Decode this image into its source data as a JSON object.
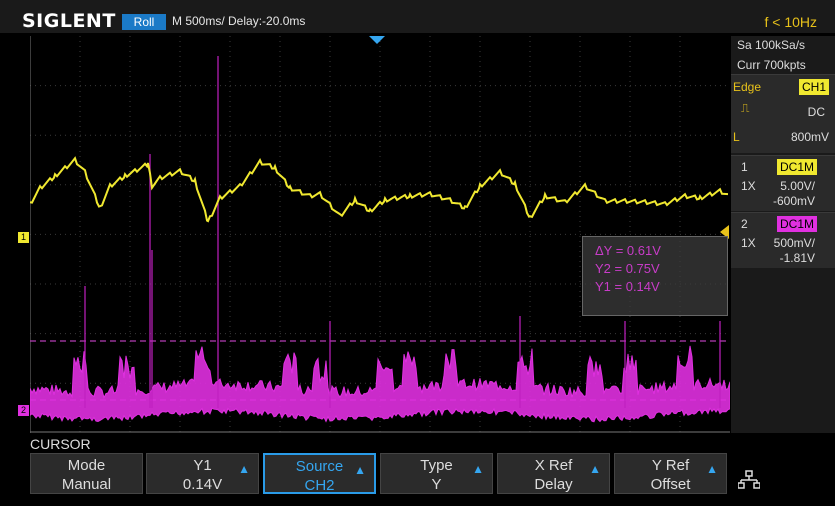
{
  "header": {
    "brand": "SIGLENT",
    "mode": "Roll",
    "timebase": "M 500ms/  Delay:-20.0ms",
    "freq": "f < 10Hz"
  },
  "panel": {
    "sample_rate": "Sa 100kSa/s",
    "memory": "Curr 700kpts",
    "trigger_type": "Edge",
    "trigger_source": "CH1",
    "trigger_coupling": "DC",
    "trigger_level_label": "L",
    "trigger_level": "800mV",
    "ch1": {
      "num": "1",
      "coupling": "DC1M",
      "probe": "1X",
      "scale": "5.00V/",
      "offset": "-600mV"
    },
    "ch2": {
      "num": "2",
      "coupling": "DC1M",
      "probe": "1X",
      "scale": "500mV/",
      "offset": "-1.81V"
    }
  },
  "readout": {
    "dy": "ΔY = 0.61V",
    "y2": "Y2 = 0.75V",
    "y1": "Y1 = 0.14V"
  },
  "menu": {
    "title": "CURSOR",
    "buttons": [
      {
        "top": "Mode",
        "bottom": "Manual"
      },
      {
        "top": "Y1",
        "bottom": "0.14V"
      },
      {
        "top": "Source",
        "bottom": "CH2"
      },
      {
        "top": "Type",
        "bottom": "Y"
      },
      {
        "top": "X Ref",
        "bottom": "Delay"
      },
      {
        "top": "Y Ref",
        "bottom": "Offset"
      }
    ]
  },
  "colors": {
    "ch1": "#f0e830",
    "ch2": "#e030e0",
    "accent": "#2a9be8",
    "trigger": "#e8c21a"
  },
  "icons": {
    "network": "network-icon"
  }
}
